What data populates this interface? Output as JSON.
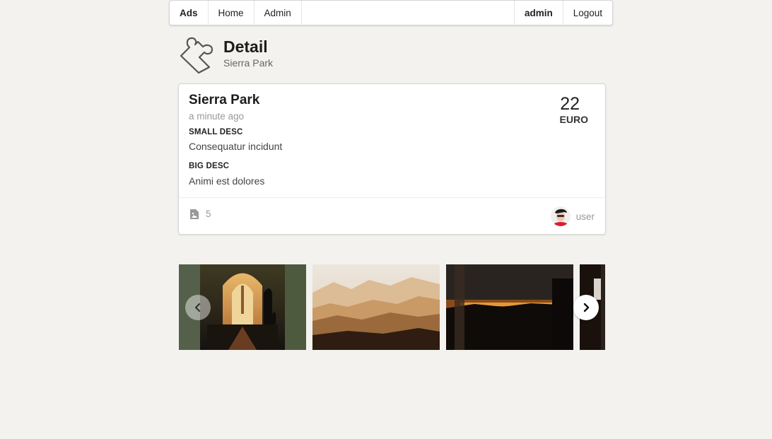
{
  "nav": {
    "ads": "Ads",
    "home": "Home",
    "admin_link": "Admin",
    "username": "admin",
    "logout": "Logout"
  },
  "header": {
    "title": "Detail",
    "subtitle": "Sierra Park",
    "icon": "puzzle-icon"
  },
  "ad": {
    "name": "Sierra Park",
    "time": "a minute ago",
    "small_desc_label": "SMALL DESC",
    "small_desc": "Consequatur incidunt",
    "big_desc_label": "BIG DESC",
    "big_desc": "Animi est dolores",
    "price": "22",
    "currency": "EURO",
    "image_count": "5",
    "author": "user"
  },
  "carousel": {
    "prev_icon": "chevron-left-icon",
    "next_icon": "chevron-right-icon"
  }
}
